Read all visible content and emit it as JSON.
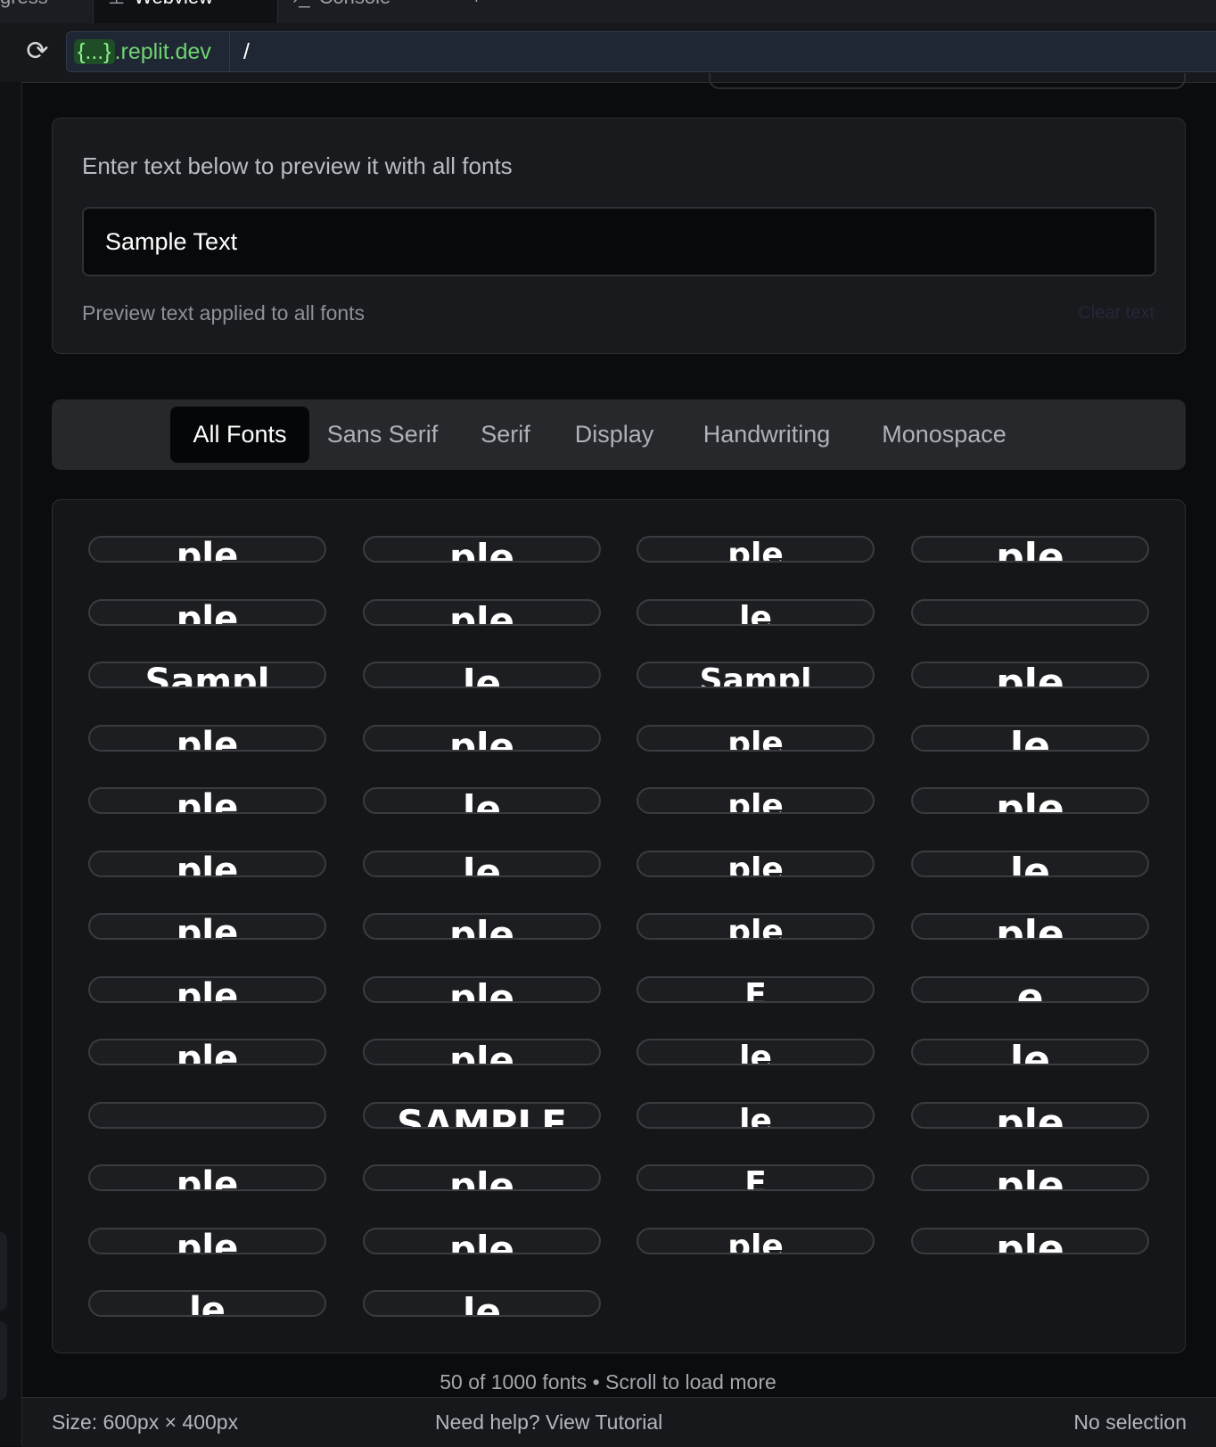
{
  "tabs": [
    {
      "label": "gress",
      "active": false
    },
    {
      "label": "Webview",
      "active": true,
      "icon": "monitor-icon"
    },
    {
      "label": "Console",
      "active": false,
      "icon": "terminal-icon"
    },
    {
      "label": "+",
      "active": false
    }
  ],
  "urlbar": {
    "domain_braces": "{...}",
    "domain_suffix": ".replit.dev",
    "path": "/"
  },
  "preview": {
    "label": "Enter text below to preview it with all fonts",
    "input_value": "Sample Text",
    "help": "Preview text applied to all fonts",
    "clear_hint": "Clear text"
  },
  "categories": [
    "All Fonts",
    "Sans Serif",
    "Serif",
    "Display",
    "Handwriting",
    "Monospace"
  ],
  "active_category": "All Fonts",
  "font_samples": [
    "ple",
    "ple",
    "ple",
    "ple",
    "ple",
    "ple",
    "le",
    "",
    "Sampl",
    "le",
    "Sampl",
    "ple",
    "ple",
    "ple",
    "ple",
    "le",
    "ple",
    "le",
    "ple",
    "ple",
    "ple",
    "le",
    "ple",
    "le",
    "ple",
    "ple",
    "ple",
    "ple",
    "ple",
    "ple",
    "E",
    "e",
    "ple",
    "ple",
    "le",
    "le",
    "",
    "SAMPLE",
    "le",
    "ple",
    "ple",
    "ple",
    "E",
    "ple",
    "ple",
    "ple",
    "ple",
    "ple",
    "le",
    "le"
  ],
  "footer": {
    "count": "50 of 1000 fonts • Scroll to load more"
  },
  "status": {
    "size": "Size: 600px × 400px",
    "help": "Need help? View Tutorial",
    "selection": "No selection"
  },
  "colors": {
    "accent_green": "#6fd36f",
    "background": "#0b0c0e",
    "card": "#191a1d"
  }
}
